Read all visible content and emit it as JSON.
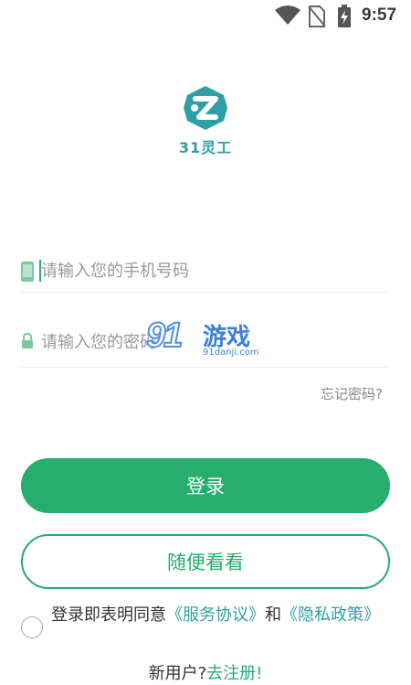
{
  "status_bar": {
    "time": "9:57",
    "icons": [
      "wifi-icon",
      "no-sim-icon",
      "battery-charging-icon"
    ]
  },
  "logo": {
    "text": "31灵工",
    "color": "#2e9fa5"
  },
  "form": {
    "phone_placeholder": "请输入您的手机号码",
    "password_placeholder": "请输入您的密码",
    "forgot_label": "忘记密码?",
    "phone_icon": "phone-icon",
    "password_icon": "lock-icon"
  },
  "buttons": {
    "login_label": "登录",
    "guest_label": "随便看看"
  },
  "agreement": {
    "prefix": "登录即表明同意",
    "service_link": "《服务协议》",
    "and": "和",
    "privacy_link": "《隐私政策》",
    "checked": false
  },
  "register": {
    "prefix": "新用户?",
    "link": "去注册!"
  },
  "watermark": {
    "number": "91",
    "text": "游戏",
    "url": "91danji.com"
  },
  "colors": {
    "accent": "#27ae6e",
    "logo_teal": "#2e9fa5",
    "placeholder": "#999999"
  }
}
